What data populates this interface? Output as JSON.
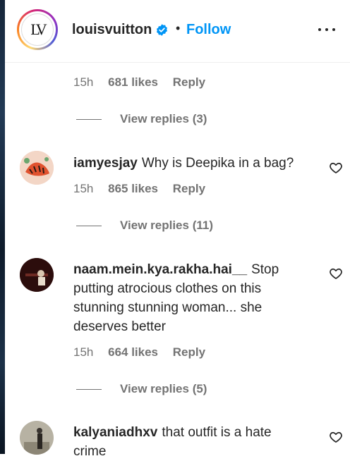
{
  "header": {
    "username": "louisvuitton",
    "separator": "•",
    "follow_label": "Follow",
    "logo_text": "LV"
  },
  "top_comment_meta": {
    "time": "15h",
    "likes": "681 likes",
    "reply": "Reply"
  },
  "top_view_replies": "View replies (3)",
  "comments": [
    {
      "username": "iamyesjay",
      "text": "Why is Deepika in a bag?",
      "time": "15h",
      "likes": "865 likes",
      "reply": "Reply",
      "view_replies": "View replies (11)"
    },
    {
      "username": "naam.mein.kya.rakha.hai__",
      "text": "Stop putting atrocious clothes on this stunning stunning woman... she deserves better",
      "time": "15h",
      "likes": "664 likes",
      "reply": "Reply",
      "view_replies": "View replies (5)"
    },
    {
      "username": "kalyaniadhxv",
      "text": "that outfit is a hate crime"
    }
  ],
  "colors": {
    "accent": "#0095f6",
    "verified": "#0095f6",
    "muted": "#737373",
    "text": "#262626"
  },
  "icons": [
    "verified-badge-icon",
    "more-options-icon",
    "heart-icon"
  ]
}
